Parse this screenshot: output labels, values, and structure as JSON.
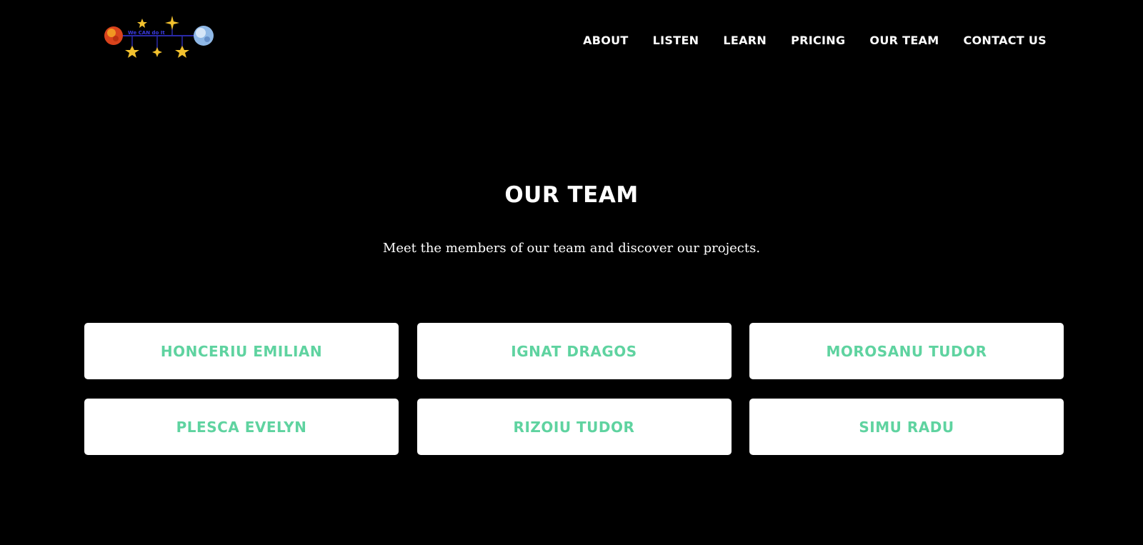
{
  "nav": {
    "items": [
      {
        "label": "ABOUT"
      },
      {
        "label": "LISTEN"
      },
      {
        "label": "LEARN"
      },
      {
        "label": "PRICING"
      },
      {
        "label": "OUR TEAM"
      },
      {
        "label": "CONTACT US"
      }
    ]
  },
  "logo": {
    "text": "We CAN do It"
  },
  "section": {
    "title": "OUR TEAM",
    "subtitle": "Meet the members of our team and discover our projects."
  },
  "team": {
    "members": [
      {
        "name": "HONCERIU EMILIAN"
      },
      {
        "name": "IGNAT DRAGOS"
      },
      {
        "name": "MOROSANU TUDOR"
      },
      {
        "name": "PLESCA EVELYN"
      },
      {
        "name": "RIZOIU TUDOR"
      },
      {
        "name": "SIMU RADU"
      }
    ]
  },
  "colors": {
    "background": "#000000",
    "accent": "#5fd3a0",
    "card": "#ffffff",
    "logo_line": "#2a2aa8",
    "star": "#f2c12e"
  }
}
